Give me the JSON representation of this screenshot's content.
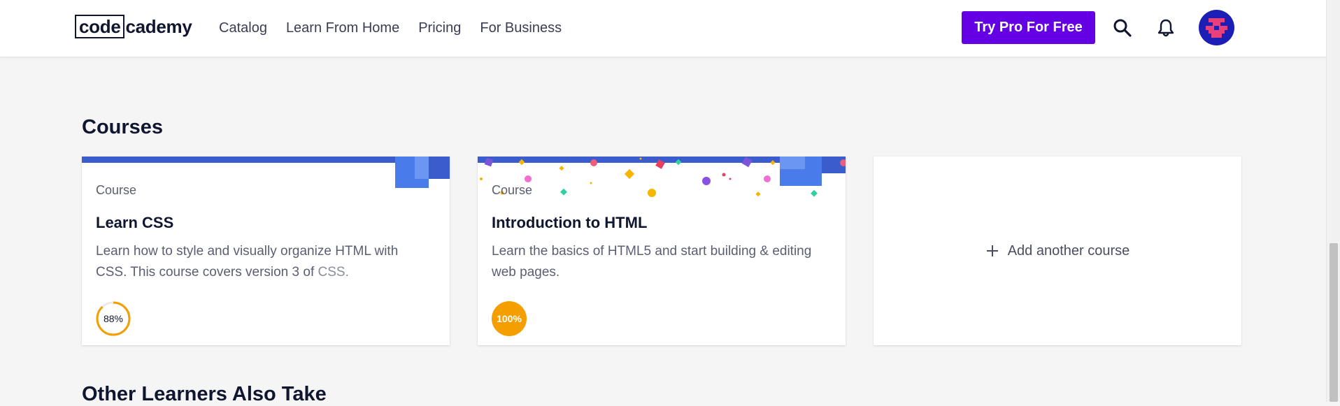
{
  "header": {
    "logo": {
      "boxed_text": "code",
      "rest_text": "cademy"
    },
    "nav": [
      "Catalog",
      "Learn From Home",
      "Pricing",
      "For Business"
    ],
    "cta_label": "Try Pro For Free",
    "icons": {
      "search": "search-icon",
      "notifications": "bell-icon",
      "avatar": "avatar-pixel-icon"
    }
  },
  "courses": {
    "title": "Courses",
    "cards": [
      {
        "type": "Course",
        "title": "Learn CSS",
        "description": "Learn how to style and visually organize HTML with CSS. This course covers version 3 of ",
        "description_faded": "CSS.",
        "progress": 88,
        "progress_label": "88%"
      },
      {
        "type": "Course",
        "title": "Introduction to HTML",
        "description": "Learn the basics of HTML5 and start building & editing web pages.",
        "progress": 100,
        "progress_label": "100%"
      }
    ],
    "add_course_label": "Add another course"
  },
  "other_learners_title": "Other Learners Also Take",
  "colors": {
    "brand_purple": "#6400e4",
    "banner_blue": "#3a5ccc",
    "progress_orange": "#f59e00",
    "avatar_bg": "#1b1fb6",
    "avatar_pink": "#e8407a"
  }
}
